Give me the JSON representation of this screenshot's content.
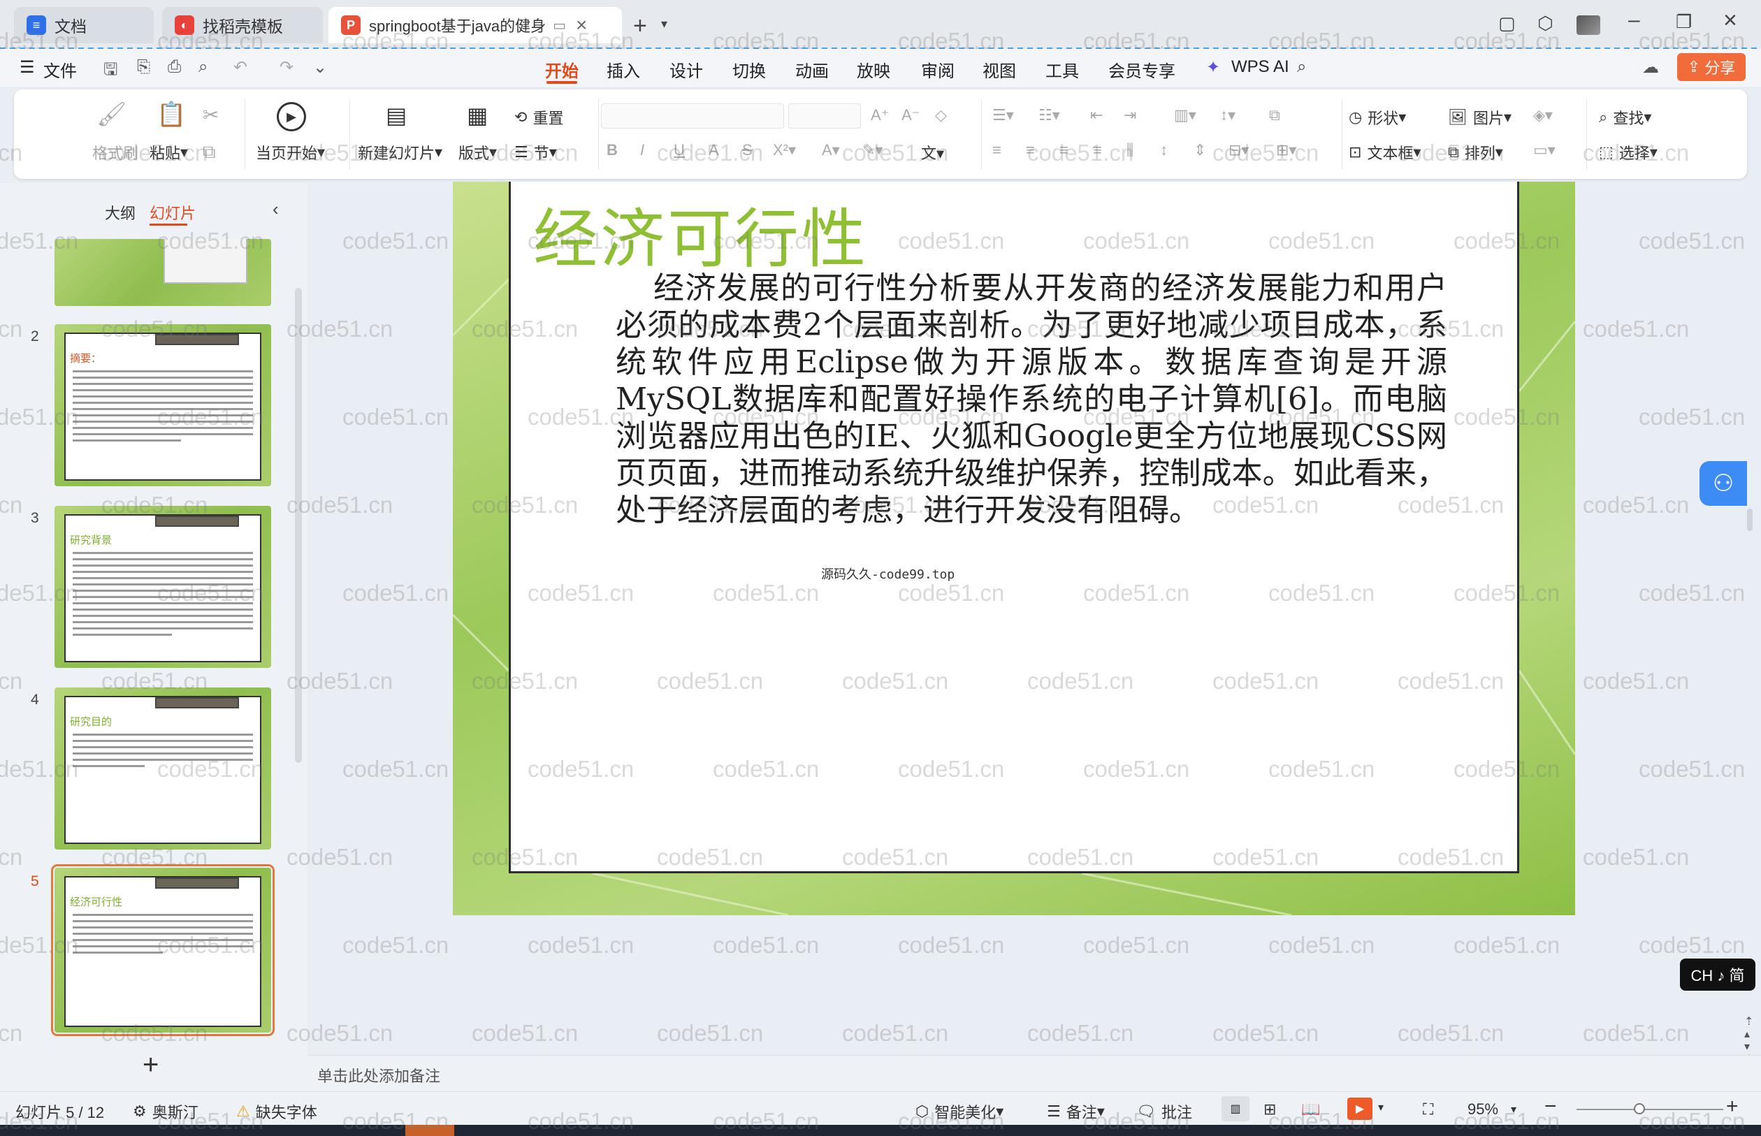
{
  "tabs": [
    {
      "label": "文档"
    },
    {
      "label": "找稻壳模板"
    },
    {
      "label": "springboot基于java的健身"
    }
  ],
  "menu": {
    "file": "文件",
    "items": [
      "开始",
      "插入",
      "设计",
      "切换",
      "动画",
      "放映",
      "审阅",
      "视图",
      "工具",
      "会员专享"
    ],
    "wps_ai": "WPS AI",
    "share": "分享"
  },
  "ribbon": {
    "format_painter": "格式刷",
    "paste": "粘贴",
    "start_from_current": "当页开始",
    "new_slide": "新建幻灯片",
    "layout": "版式",
    "reset": "重置",
    "section": "节",
    "shape": "形状",
    "picture": "图片",
    "find": "查找",
    "textbox": "文本框",
    "arrange": "排列",
    "select": "选择"
  },
  "panel": {
    "outline_tab": "大纲",
    "slides_tab": "幻灯片",
    "thumbnails": [
      {
        "num": "2",
        "title": "摘要："
      },
      {
        "num": "3",
        "title": "研究背景"
      },
      {
        "num": "4",
        "title": "研究目的"
      },
      {
        "num": "5",
        "title": "经济可行性"
      }
    ]
  },
  "slide": {
    "title": "经济可行性",
    "body": "经济发展的可行性分析要从开发商的经济发展能力和用户必须的成本费2个层面来剖析。为了更好地减少项目成本，系统软件应用Eclipse做为开源版本。数据库查询是开源MySQL数据库和配置好操作系统的电子计算机[6]。而电脑浏览器应用出色的IE、火狐和Google更全方位地展现CSS网页页面，进而推动系统升级维护保养，控制成本。如此看来，处于经济层面的考虑，进行开发没有阻碍。",
    "footer_text": "源码久久-code99.top"
  },
  "notes_placeholder": "单击此处添加备注",
  "status": {
    "slide_counter": "幻灯片 5 / 12",
    "theme": "奥斯汀",
    "missing_font": "缺失字体",
    "smart_beautify": "智能美化",
    "notes": "备注",
    "comments": "批注",
    "zoom": "95%"
  },
  "ime": "CH ♪ 简",
  "watermark": "code51.cn",
  "colors": {
    "accent_orange": "#f05a28",
    "slide_green": "#8dbf45",
    "title_green": "#8fbf32",
    "share_btn": "#f26b3a"
  }
}
